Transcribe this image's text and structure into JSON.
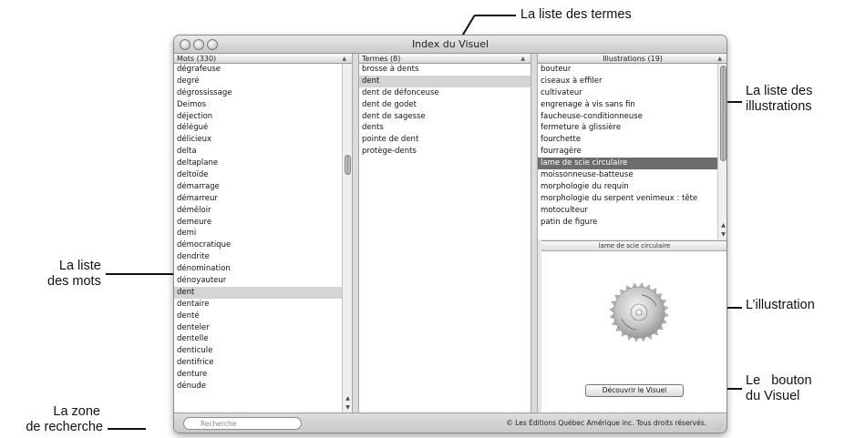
{
  "window": {
    "title": "Index du Visuel"
  },
  "words": {
    "header": "Mots (330)",
    "items": [
      "dégrafeuse",
      "degré",
      "dégrossissage",
      "Deimos",
      "déjection",
      "délégué",
      "délicieux",
      "delta",
      "deltaplane",
      "deltoïde",
      "démarrage",
      "démarreur",
      "démêloir",
      "demeure",
      "demi",
      "démocratique",
      "dendrite",
      "dénomination",
      "dénoyauteur",
      "dent",
      "dentaire",
      "denté",
      "denteler",
      "dentelle",
      "denticule",
      "dentifrice",
      "denture",
      "dénude"
    ],
    "selected": "dent"
  },
  "terms": {
    "header": "Termes (8)",
    "items": [
      "brosse à dents",
      "dent",
      "dent de défonceuse",
      "dent de godet",
      "dent de sagesse",
      "dents",
      "pointe de dent",
      "protège-dents"
    ],
    "selected": "dent"
  },
  "illustrations": {
    "header": "Illustrations (19)",
    "items": [
      "bouteur",
      "ciseaux à effiler",
      "cultivateur",
      "engrenage à vis sans fin",
      "faucheuse-conditionneuse",
      "fermeture à glissière",
      "fourchette",
      "fourragère",
      "lame de scie circulaire",
      "moissonneuse-batteuse",
      "morphologie du requin",
      "morphologie du serpent venimeux : tête",
      "motoculteur",
      "patin de figure"
    ],
    "selected": "lame de scie circulaire"
  },
  "preview": {
    "caption": "lame de scie circulaire",
    "button_label": "Découvrir le Visuel"
  },
  "bottom": {
    "search_placeholder": "Recherche",
    "copyright": "©  Les Éditions Québec Amérique inc. Tous droits réservés."
  },
  "callouts": {
    "terms_list": "La liste des termes",
    "illustrations_list_1": "La liste des",
    "illustrations_list_2": "illustrations",
    "words_list_1": "La liste",
    "words_list_2": "des mots",
    "illustration": "L’illustration",
    "button_1": "Le   bouton",
    "button_2": "du Visuel",
    "search_zone_1": "La zone",
    "search_zone_2": "de recherche"
  },
  "icons": {
    "window_controls": [
      "close-icon",
      "minimize-icon",
      "zoom-icon"
    ],
    "search": "magnifier-icon",
    "sort": "sort-ascending-icon",
    "resize": "resize-grip-icon"
  },
  "colors": {
    "selection_dark": "#6d6d6d",
    "selection_grey": "#d4d4d4",
    "window_chrome": "#e6e6e6"
  }
}
